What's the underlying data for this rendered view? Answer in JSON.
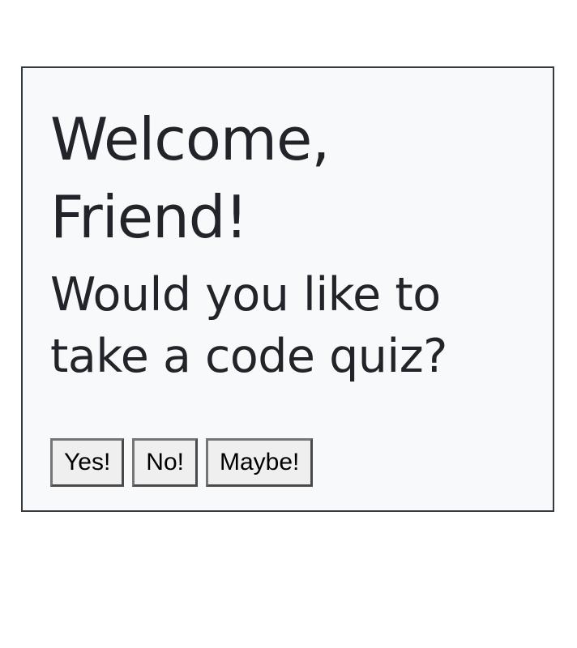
{
  "header": {
    "title": "Welcome, Friend!",
    "prompt": "Would you like to take a code quiz?"
  },
  "buttons": [
    {
      "label": "Yes!"
    },
    {
      "label": "No!"
    },
    {
      "label": "Maybe!"
    }
  ],
  "colors": {
    "card_background": "#f8f9fa",
    "card_border": "#343a40",
    "text": "#212529",
    "button_background": "#efefef"
  }
}
